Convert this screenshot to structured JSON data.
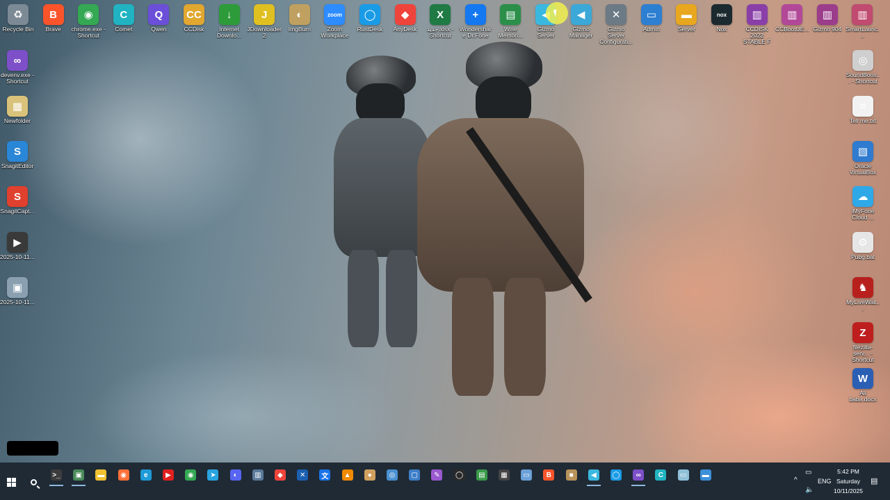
{
  "desktop": {
    "top_icons": [
      {
        "label": "Recycle Bin",
        "icon": "recycle-bin-icon",
        "color": "#7c8a96",
        "glyph": "♻"
      },
      {
        "label": "Brave",
        "icon": "brave-icon",
        "color": "#fb542b",
        "glyph": "B"
      },
      {
        "label": "chrome.exe - Shortcut",
        "icon": "chrome-icon",
        "color": "#34a853",
        "glyph": "◉"
      },
      {
        "label": "Comet",
        "icon": "comet-icon",
        "color": "#21b3c2",
        "glyph": "C"
      },
      {
        "label": "Qwen",
        "icon": "qwen-icon",
        "color": "#6b4fd8",
        "glyph": "Q"
      },
      {
        "label": "CCDisk",
        "icon": "ccdisk-icon",
        "color": "#e2a72e",
        "glyph": "CC"
      },
      {
        "label": "Internet Downlo...",
        "icon": "idm-icon",
        "color": "#2e9b3a",
        "glyph": "↓"
      },
      {
        "label": "JDownloader 2",
        "icon": "jdownloader-icon",
        "color": "#e0c020",
        "glyph": "J"
      },
      {
        "label": "ImgBurn",
        "icon": "imgburn-icon",
        "color": "#c0a060",
        "glyph": "◐"
      },
      {
        "label": "Zoom Workplace",
        "icon": "zoom-icon",
        "color": "#2d8cff",
        "glyph": "zoom"
      },
      {
        "label": "RustDesk",
        "icon": "rustdesk-icon",
        "color": "#1a9be6",
        "glyph": "◯"
      },
      {
        "label": "AnyDesk",
        "icon": "anydesk-icon",
        "color": "#ef443b",
        "glyph": "◆"
      },
      {
        "label": "جدید.xlsx - Shortcut",
        "icon": "excel-icon",
        "color": "#1f7a44",
        "glyph": "X"
      },
      {
        "label": "Wondershare Dr.Fone",
        "icon": "drfone-icon",
        "color": "#1478f0",
        "glyph": "+"
      },
      {
        "label": "Wise Memori...",
        "icon": "wise-memory-icon",
        "color": "#2b8f4a",
        "glyph": "▤"
      },
      {
        "label": "Gizmo Server",
        "icon": "gizmo-server-icon",
        "color": "#3bb8e0",
        "glyph": "◀"
      },
      {
        "label": "Gizmo Manager",
        "icon": "gizmo-manager-icon",
        "color": "#3ba8d8",
        "glyph": "◀"
      },
      {
        "label": "Gizmo Server Configurati...",
        "icon": "gizmo-config-icon",
        "color": "#6c7a86",
        "glyph": "✕"
      },
      {
        "label": "Admin",
        "icon": "admin-icon",
        "color": "#2d7fd1",
        "glyph": "▭"
      },
      {
        "label": "Server",
        "icon": "server-icon",
        "color": "#e8a71e",
        "glyph": "▬"
      },
      {
        "label": "Nox",
        "icon": "nox-icon",
        "color": "#1b2a2f",
        "glyph": "nox"
      },
      {
        "label": "CCDISK 2022 STABLE F U...",
        "icon": "winrar-icon",
        "color": "#8a3fa8",
        "glyph": "▥"
      },
      {
        "label": "CCBootUE...",
        "icon": "winrar-icon",
        "color": "#b24898",
        "glyph": "▥"
      },
      {
        "label": "Gizmo 904",
        "icon": "winrar-icon",
        "color": "#9c3d8c",
        "glyph": "▥"
      },
      {
        "label": "SmartLaunc...",
        "icon": "winrar-icon",
        "color": "#c04a70",
        "glyph": "▥"
      }
    ],
    "left_icons": [
      {
        "label": "devenv.exe - Shortcut",
        "icon": "visual-studio-icon",
        "color": "#7d4fc8",
        "glyph": "∞"
      },
      {
        "label": "Newfolder",
        "icon": "archive-icon",
        "color": "#d9c27a",
        "glyph": "▦"
      },
      {
        "label": "SnagitEditor",
        "icon": "snagit-editor-icon",
        "color": "#2a86d6",
        "glyph": "S"
      },
      {
        "label": "SnagitCapt...",
        "icon": "snagit-capture-icon",
        "color": "#e0402e",
        "glyph": "S"
      },
      {
        "label": "2025-10-11...",
        "icon": "video-file-icon",
        "color": "#3a3a3a",
        "glyph": "▶"
      },
      {
        "label": "2025-10-11...",
        "icon": "image-file-icon",
        "color": "#8aa0b0",
        "glyph": "▣"
      }
    ],
    "right_icons": [
      {
        "label": "SoundBoos... - Shortcut",
        "icon": "soundbooster-icon",
        "color": "#cfcfcf",
        "glyph": "◎"
      },
      {
        "label": "Tell me.txt",
        "icon": "text-file-icon",
        "color": "#f2f2f2",
        "glyph": "≡"
      },
      {
        "label": "Oracle VirtualBox",
        "icon": "virtualbox-icon",
        "color": "#2e7bd0",
        "glyph": "▧"
      },
      {
        "label": "iMyFone Cloud ...",
        "icon": "imyfone-icon",
        "color": "#2fa8e8",
        "glyph": "☁"
      },
      {
        "label": "Pubg.bat",
        "icon": "bat-file-icon",
        "color": "#e6e6e6",
        "glyph": "⚙"
      },
      {
        "label": "MyLiveWall...",
        "icon": "mylivewallpaper-icon",
        "color": "#b8201d",
        "glyph": "♞"
      },
      {
        "label": "filezilla-serv... - Shortcut",
        "icon": "filezilla-icon",
        "color": "#bf1e1e",
        "glyph": "Z"
      },
      {
        "label": "Ali baba.docx",
        "icon": "word-icon",
        "color": "#2b5fb4",
        "glyph": "W"
      }
    ]
  },
  "taskbar": {
    "pinned": [
      {
        "icon": "terminal-icon",
        "color": "#3c3c3c",
        "glyph": ">_"
      },
      {
        "icon": "control-panel-icon",
        "color": "#4a8a5a",
        "glyph": "▣"
      },
      {
        "icon": "file-explorer-icon",
        "color": "#f0c030",
        "glyph": "▬"
      },
      {
        "icon": "firefox-icon",
        "color": "#ff7139",
        "glyph": "◉"
      },
      {
        "icon": "edge-icon",
        "color": "#1f9bd8",
        "glyph": "e"
      },
      {
        "icon": "youtube-icon",
        "color": "#e02020",
        "glyph": "▶"
      },
      {
        "icon": "chrome-icon",
        "color": "#34a853",
        "glyph": "◉"
      },
      {
        "icon": "telegram-icon",
        "color": "#2aa4e0",
        "glyph": "➤"
      },
      {
        "icon": "discord-icon",
        "color": "#5865f2",
        "glyph": "◐"
      },
      {
        "icon": "winrar-icon",
        "color": "#5a7a9a",
        "glyph": "▥"
      },
      {
        "icon": "anydesk-icon",
        "color": "#ef443b",
        "glyph": "◆"
      },
      {
        "icon": "vscode-blue-icon",
        "color": "#1b5fb0",
        "glyph": "✕"
      },
      {
        "icon": "translate-icon",
        "color": "#1a73e8",
        "glyph": "文"
      },
      {
        "icon": "vlc-icon",
        "color": "#f08a00",
        "glyph": "▲"
      },
      {
        "icon": "media-player-icon",
        "color": "#d0a060",
        "glyph": "●"
      },
      {
        "icon": "network-icon",
        "color": "#4a90d0",
        "glyph": "◎"
      },
      {
        "icon": "snip-icon",
        "color": "#3d7fc8",
        "glyph": "▢"
      },
      {
        "icon": "feather-icon",
        "color": "#9b59d0",
        "glyph": "✎"
      },
      {
        "icon": "github-icon",
        "color": "#2b2b2b",
        "glyph": "◯"
      },
      {
        "icon": "notepad-green-icon",
        "color": "#3a9a4a",
        "glyph": "▤"
      },
      {
        "icon": "calculator-icon",
        "color": "#444444",
        "glyph": "▦"
      },
      {
        "icon": "notepad-icon",
        "color": "#6ba0d8",
        "glyph": "▭"
      },
      {
        "icon": "brave-icon",
        "color": "#fb542b",
        "glyph": "B"
      },
      {
        "icon": "package-icon",
        "color": "#b8935a",
        "glyph": "■"
      },
      {
        "icon": "gizmo-icon",
        "color": "#3bb8e0",
        "glyph": "◀"
      },
      {
        "icon": "rustdesk-icon",
        "color": "#1a9be6",
        "glyph": "◯"
      },
      {
        "icon": "visual-studio-icon",
        "color": "#7d4fc8",
        "glyph": "∞"
      },
      {
        "icon": "comet-icon",
        "color": "#21b3c2",
        "glyph": "C"
      },
      {
        "icon": "notes-icon",
        "color": "#8fc0d8",
        "glyph": "▭"
      },
      {
        "icon": "window-icon",
        "color": "#3d8fd8",
        "glyph": "▬"
      }
    ],
    "tray": {
      "language": "ENG",
      "time": "5:42 PM",
      "day": "Saturday",
      "date": "10/11/2025"
    }
  }
}
